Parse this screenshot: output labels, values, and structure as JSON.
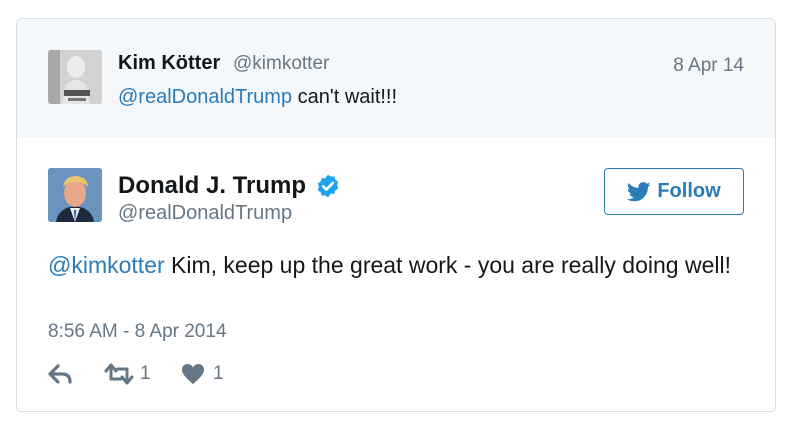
{
  "colors": {
    "link": "#2b7bb9",
    "muted": "#657786",
    "verified": "#1da1f2",
    "card_border": "#d8dee3",
    "parent_bg": "#f5f8fa"
  },
  "parent_tweet": {
    "name": "Kim Kötter",
    "handle": "@kimkotter",
    "date": "8 Apr 14",
    "mention": "@realDonaldTrump",
    "text": " can't wait!!!"
  },
  "tweet": {
    "name": "Donald J. Trump",
    "handle": "@realDonaldTrump",
    "verified_icon": "verified-badge-icon",
    "follow_label": "Follow",
    "mention": "@kimkotter",
    "text": " Kim, keep up the great work - you are really doing well!",
    "timestamp": "8:56 AM - 8 Apr 2014",
    "retweet_count": "1",
    "like_count": "1"
  }
}
